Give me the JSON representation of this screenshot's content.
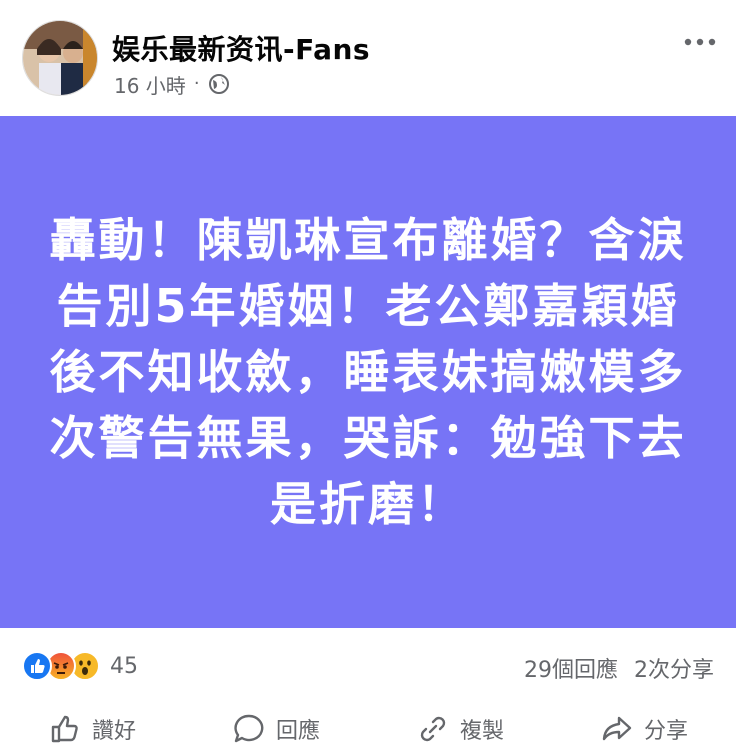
{
  "author": {
    "name": "娱乐最新资讯-Fans",
    "time": "16 小時",
    "dot": "·",
    "privacy_icon": "globe-icon"
  },
  "post": {
    "text": "轟動！陳凱琳宣布離婚？含淚告別5年婚姻！老公鄭嘉穎婚後不知收斂，睡表妹搞嫩模多次警告無果，哭訴：勉強下去是折磨！",
    "background_color": "#7774f6"
  },
  "stats": {
    "reaction_count": "45",
    "comments": "29個回應",
    "shares": "2次分享",
    "reactions": [
      "like-icon",
      "angry-icon",
      "wow-icon"
    ]
  },
  "actions": {
    "like": "讚好",
    "comment": "回應",
    "copy": "複製",
    "share": "分享"
  }
}
